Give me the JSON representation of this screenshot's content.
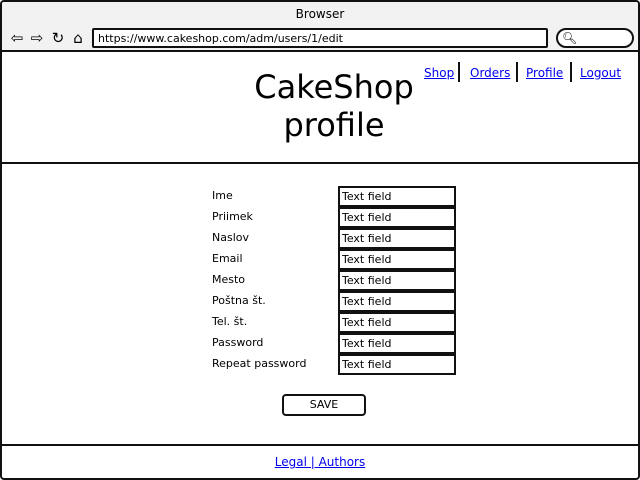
{
  "window": {
    "title": "Browser"
  },
  "toolbar": {
    "url": "https://www.cakeshop.com/adm/users/1/edit",
    "icons": [
      "back-arrow-icon",
      "forward-arrow-icon",
      "refresh-icon",
      "home-icon",
      "search-icon"
    ]
  },
  "header": {
    "title_line1": "CakeShop",
    "title_line2": "profile",
    "nav": {
      "shop": "Shop",
      "orders": "Orders",
      "profile": "Profile",
      "logout": "Logout"
    }
  },
  "form": {
    "fields": [
      {
        "label": "Ime",
        "value": "Text field"
      },
      {
        "label": "Priimek",
        "value": "Text field"
      },
      {
        "label": "Naslov",
        "value": "Text field"
      },
      {
        "label": "Email",
        "value": "Text field"
      },
      {
        "label": "Mesto",
        "value": "Text field"
      },
      {
        "label": "Poštna št.",
        "value": "Text field"
      },
      {
        "label": "Tel. št.",
        "value": "Text field"
      },
      {
        "label": "Password",
        "value": "Text field"
      },
      {
        "label": "Repeat password",
        "value": "Text field"
      }
    ],
    "save_label": "SAVE"
  },
  "footer": {
    "links": "Legal | Authors"
  }
}
